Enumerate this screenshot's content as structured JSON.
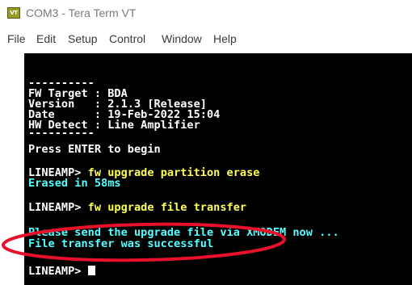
{
  "window": {
    "title": "COM3 - Tera Term VT",
    "app_icon_text": "VT"
  },
  "menu": {
    "items": [
      "File",
      "Edit",
      "Setup",
      "Control",
      "Window",
      "Help"
    ]
  },
  "terminal": {
    "lines": [
      {
        "text": "----------",
        "color": "white"
      },
      {
        "text": "FW Target : BDA",
        "color": "white"
      },
      {
        "text": "Version   : 2.1.3 [Release]",
        "color": "white"
      },
      {
        "text": "Date      : 19-Feb-2022 15:04",
        "color": "white"
      },
      {
        "text": "HW Detect : Line Amplifier",
        "color": "white"
      },
      {
        "text": "----------",
        "color": "white"
      },
      {
        "text": "Press ENTER to begin",
        "color": "white"
      },
      {
        "prompt": "LINEAMP> ",
        "command": "fw upgrade partition erase"
      },
      {
        "text": "Erased in 58ms",
        "color": "cyan"
      },
      {
        "prompt": "LINEAMP> ",
        "command": "fw upgrade file transfer"
      },
      {
        "text": "Please send the upgrade file via XMODEM now ...",
        "color": "cyan"
      },
      {
        "text": "File transfer was successful",
        "color": "cyan"
      },
      {
        "prompt": "LINEAMP> ",
        "command": ""
      }
    ]
  },
  "colors": {
    "terminal_bg": "#000000",
    "prompt": "#ffffff",
    "command": "#ffff55",
    "response": "#55ffff",
    "annotation": "#e8102a"
  }
}
